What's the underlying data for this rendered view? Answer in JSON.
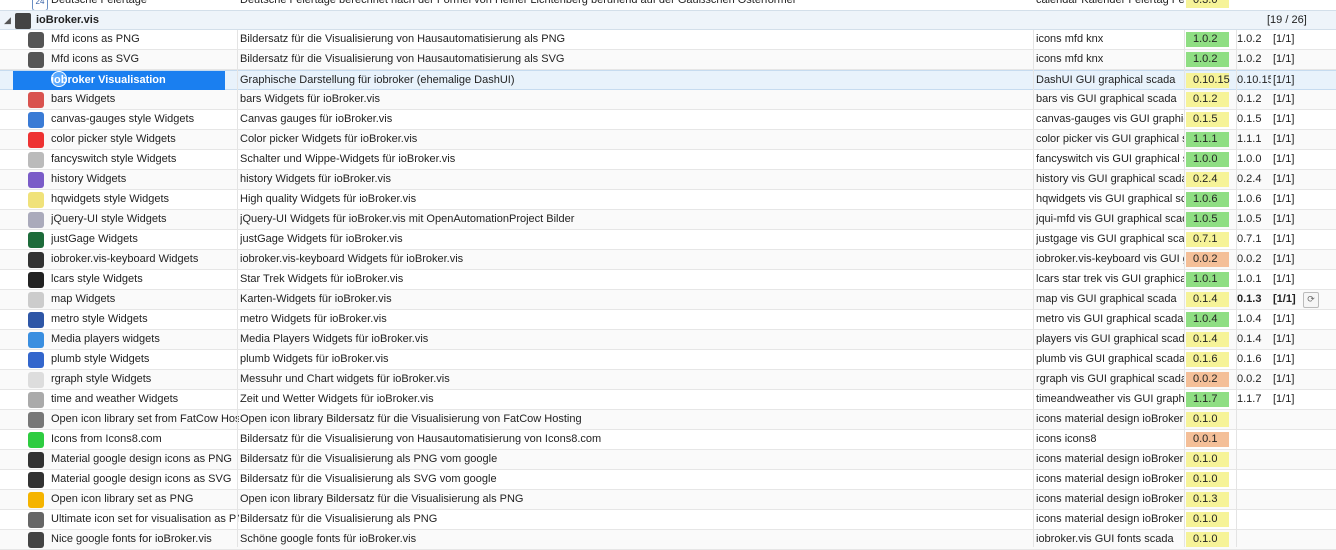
{
  "top_partial": {
    "name": "Deutsche Feiertage",
    "desc": "Deutsche Feiertage berechnet nach der Formel von Heiner Lichtenberg beruhend auf der Gaußschen Osterformel",
    "keywords": "calendar Kalender Feiertag Fer",
    "version": "0.3.0"
  },
  "group": {
    "title": "ioBroker.vis",
    "count": "[19 / 26]"
  },
  "rows": [
    {
      "name": "Mfd icons as PNG",
      "desc": "Bildersatz für die Visualisierung von Hausautomatisierung als PNG",
      "keywords": "icons mfd knx",
      "version": "1.0.2",
      "color": "green",
      "installed": "1.0.2",
      "count": "[1/1]",
      "icon": "house-outline-icon",
      "iconColor": "#555"
    },
    {
      "name": "Mfd icons as SVG",
      "desc": "Bildersatz für die Visualisierung von Hausautomatisierung als SVG",
      "keywords": "icons mfd knx",
      "version": "1.0.2",
      "color": "green",
      "installed": "1.0.2",
      "count": "[1/1]",
      "icon": "house-outline-icon",
      "iconColor": "#555"
    },
    {
      "name": "iobroker Visualisation",
      "desc": "Graphische Darstellung für iobroker (ehemalige DashUI)",
      "keywords": "DashUI GUI graphical scada",
      "version": "0.10.15",
      "color": "yellow",
      "installed": "0.10.15",
      "count": "[1/1]",
      "icon": "vis-icon",
      "iconColor": "#5aa9ff",
      "selected": true
    },
    {
      "name": "bars Widgets",
      "desc": "bars Widgets für ioBroker.vis",
      "keywords": "bars vis GUI graphical scada",
      "version": "0.1.2",
      "color": "yellow",
      "installed": "0.1.2",
      "count": "[1/1]",
      "icon": "bars-icon",
      "iconColor": "#d9534f"
    },
    {
      "name": "canvas-gauges style Widgets",
      "desc": "Canvas gauges für ioBroker.vis",
      "keywords": "canvas-gauges vis GUI graphica",
      "version": "0.1.5",
      "color": "yellow",
      "installed": "0.1.5",
      "count": "[1/1]",
      "icon": "gauge-icon",
      "iconColor": "#3a7bd5"
    },
    {
      "name": "color picker style Widgets",
      "desc": "Color picker Widgets für ioBroker.vis",
      "keywords": "color picker vis GUI graphical sc",
      "version": "1.1.1",
      "color": "green",
      "installed": "1.1.1",
      "count": "[1/1]",
      "icon": "color-wheel-icon",
      "iconColor": "#e33"
    },
    {
      "name": "fancyswitch style Widgets",
      "desc": "Schalter und Wippe-Widgets für ioBroker.vis",
      "keywords": "fancyswitch vis GUI graphical sc",
      "version": "1.0.0",
      "color": "green",
      "installed": "1.0.0",
      "count": "[1/1]",
      "icon": "switch-icon",
      "iconColor": "#bbb"
    },
    {
      "name": "history Widgets",
      "desc": "history Widgets für ioBroker.vis",
      "keywords": "history vis GUI graphical scada",
      "version": "0.2.4",
      "color": "yellow",
      "installed": "0.2.4",
      "count": "[1/1]",
      "icon": "waveform-icon",
      "iconColor": "#7a5cc8"
    },
    {
      "name": "hqwidgets style Widgets",
      "desc": "High quality Widgets für ioBroker.vis",
      "keywords": "hqwidgets vis GUI graphical sca",
      "version": "1.0.6",
      "color": "green",
      "installed": "1.0.6",
      "count": "[1/1]",
      "icon": "lightbulb-icon",
      "iconColor": "#f0e27a"
    },
    {
      "name": "jQuery-UI style Widgets",
      "desc": "jQuery-UI Widgets für ioBroker.vis mit OpenAutomationProject Bilder",
      "keywords": "jqui-mfd vis GUI graphical scada",
      "version": "1.0.5",
      "color": "green",
      "installed": "1.0.5",
      "count": "[1/1]",
      "icon": "jquery-icon",
      "iconColor": "#aab"
    },
    {
      "name": "justGage Widgets",
      "desc": "justGage Widgets für ioBroker.vis",
      "keywords": "justgage vis GUI graphical scad",
      "version": "0.7.1",
      "color": "yellow",
      "installed": "0.7.1",
      "count": "[1/1]",
      "icon": "gauge-icon",
      "iconColor": "#1d6b3a"
    },
    {
      "name": "iobroker.vis-keyboard Widgets",
      "desc": "iobroker.vis-keyboard Widgets für ioBroker.vis",
      "keywords": "iobroker.vis-keyboard vis GUI gi",
      "version": "0.0.2",
      "color": "orange",
      "installed": "0.0.2",
      "count": "[1/1]",
      "icon": "keyboard-icon",
      "iconColor": "#333"
    },
    {
      "name": "lcars style Widgets",
      "desc": "Star Trek Widgets für ioBroker.vis",
      "keywords": "lcars star trek vis GUI graphical",
      "version": "1.0.1",
      "color": "green",
      "installed": "1.0.1",
      "count": "[1/1]",
      "icon": "star-trek-icon",
      "iconColor": "#222"
    },
    {
      "name": "map Widgets",
      "desc": "Karten-Widgets für ioBroker.vis",
      "keywords": "map vis GUI graphical scada",
      "version": "0.1.4",
      "color": "yellow",
      "installed": "0.1.3",
      "count": "[1/1]",
      "icon": "compass-icon",
      "iconColor": "#ccc",
      "bold": true,
      "update": true
    },
    {
      "name": "metro style Widgets",
      "desc": "metro Widgets für ioBroker.vis",
      "keywords": "metro vis GUI graphical scada",
      "version": "1.0.4",
      "color": "green",
      "installed": "1.0.4",
      "count": "[1/1]",
      "icon": "metro-tiles-icon",
      "iconColor": "#2e56a6"
    },
    {
      "name": "Media players widgets",
      "desc": "Media Players Widgets für ioBroker.vis",
      "keywords": "players vis GUI graphical scada",
      "version": "0.1.4",
      "color": "yellow",
      "installed": "0.1.4",
      "count": "[1/1]",
      "icon": "music-note-icon",
      "iconColor": "#3b8fe0"
    },
    {
      "name": "plumb style Widgets",
      "desc": "plumb Widgets für ioBroker.vis",
      "keywords": "plumb vis GUI graphical scada",
      "version": "0.1.6",
      "color": "yellow",
      "installed": "0.1.6",
      "count": "[1/1]",
      "icon": "thermometer-icon",
      "iconColor": "#3366cc"
    },
    {
      "name": "rgraph style Widgets",
      "desc": "Messuhr und Chart widgets für ioBroker.vis",
      "keywords": "rgraph vis GUI graphical scada",
      "version": "0.0.2",
      "color": "orange",
      "installed": "0.0.2",
      "count": "[1/1]",
      "icon": "dial-icon",
      "iconColor": "#ddd"
    },
    {
      "name": "time and weather Widgets",
      "desc": "Zeit und Wetter Widgets für ioBroker.vis",
      "keywords": "timeandweather vis GUI graphic",
      "version": "1.1.7",
      "color": "green",
      "installed": "1.1.7",
      "count": "[1/1]",
      "icon": "weather-icon",
      "iconColor": "#aaa"
    },
    {
      "name": "Open icon library set from FatCow Hosting",
      "desc": "Open icon library Bildersatz für die Visualisierung von FatCow Hosting",
      "keywords": "icons material design ioBroker",
      "version": "0.1.0",
      "color": "yellow",
      "installed": "",
      "count": "",
      "icon": "cow-icon",
      "iconColor": "#777"
    },
    {
      "name": "Icons from Icons8.com",
      "desc": "Bildersatz für die Visualisierung von Hausautomatisierung von Icons8.com",
      "keywords": "icons icons8",
      "version": "0.0.1",
      "color": "orange",
      "installed": "",
      "count": "",
      "icon": "icons8-icon",
      "iconColor": "#2ecc40"
    },
    {
      "name": "Material google design icons as PNG",
      "desc": "Bildersatz für die Visualisierung als PNG vom google",
      "keywords": "icons material design ioBroker",
      "version": "0.1.0",
      "color": "yellow",
      "installed": "",
      "count": "",
      "icon": "android-icon",
      "iconColor": "#333"
    },
    {
      "name": "Material google design icons as SVG",
      "desc": "Bildersatz für die Visualisierung als SVG vom google",
      "keywords": "icons material design ioBroker",
      "version": "0.1.0",
      "color": "yellow",
      "installed": "",
      "count": "",
      "icon": "android-icon",
      "iconColor": "#333"
    },
    {
      "name": "Open icon library set as PNG",
      "desc": "Open icon library Bildersatz für die Visualisierung als PNG",
      "keywords": "icons material design ioBroker",
      "version": "0.1.3",
      "color": "yellow",
      "installed": "",
      "count": "",
      "icon": "star-icon",
      "iconColor": "#f5b400"
    },
    {
      "name": "Ultimate icon set for visualisation as PNG",
      "desc": "Bildersatz für die Visualisierung als PNG",
      "keywords": "icons material design ioBroker",
      "version": "0.1.0",
      "color": "yellow",
      "installed": "",
      "count": "",
      "icon": "house-outline-icon",
      "iconColor": "#666"
    },
    {
      "name": "Nice google fonts for ioBroker.vis",
      "desc": "Schöne google fonts für ioBroker.vis",
      "keywords": "iobroker.vis GUI fonts scada",
      "version": "0.1.0",
      "color": "yellow",
      "installed": "",
      "count": "",
      "icon": "fonts-icon",
      "iconColor": "#444"
    }
  ]
}
